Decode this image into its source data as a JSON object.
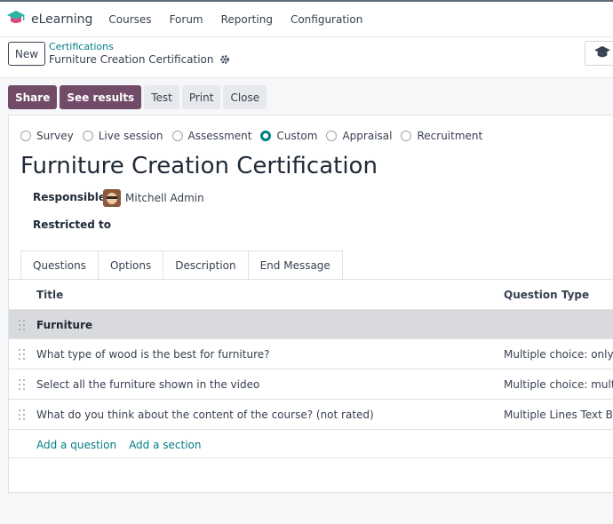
{
  "navbar": {
    "app_name": "eLearning",
    "menu": [
      "Courses",
      "Forum",
      "Reporting",
      "Configuration"
    ]
  },
  "control": {
    "new_label": "New",
    "breadcrumb": "Certifications",
    "record_name": "Furniture Creation Certification"
  },
  "actions": {
    "share": "Share",
    "see_results": "See results",
    "test": "Test",
    "print": "Print",
    "close": "Close"
  },
  "form": {
    "survey_types": [
      {
        "label": "Survey",
        "checked": false
      },
      {
        "label": "Live session",
        "checked": false
      },
      {
        "label": "Assessment",
        "checked": false
      },
      {
        "label": "Custom",
        "checked": true
      },
      {
        "label": "Appraisal",
        "checked": false
      },
      {
        "label": "Recruitment",
        "checked": false
      }
    ],
    "title": "Furniture Creation Certification",
    "responsible_label": "Responsible",
    "responsible_value": "Mitchell Admin",
    "restricted_label": "Restricted to"
  },
  "tabs": [
    "Questions",
    "Options",
    "Description",
    "End Message"
  ],
  "table": {
    "col_title": "Title",
    "col_type": "Question Type",
    "rows": [
      {
        "title": "Furniture",
        "type": "",
        "section": true
      },
      {
        "title": "What type of wood is the best for furniture?",
        "type": "Multiple choice: only on",
        "section": false
      },
      {
        "title": "Select all the furniture shown in the video",
        "type": "Multiple choice: multiple",
        "section": false
      },
      {
        "title": "What do you think about the content of the course? (not rated)",
        "type": "Multiple Lines Text Box",
        "section": false
      }
    ],
    "add_question": "Add a question",
    "add_section": "Add a section"
  },
  "colors": {
    "primary": "#714b67",
    "link": "#017e84"
  }
}
